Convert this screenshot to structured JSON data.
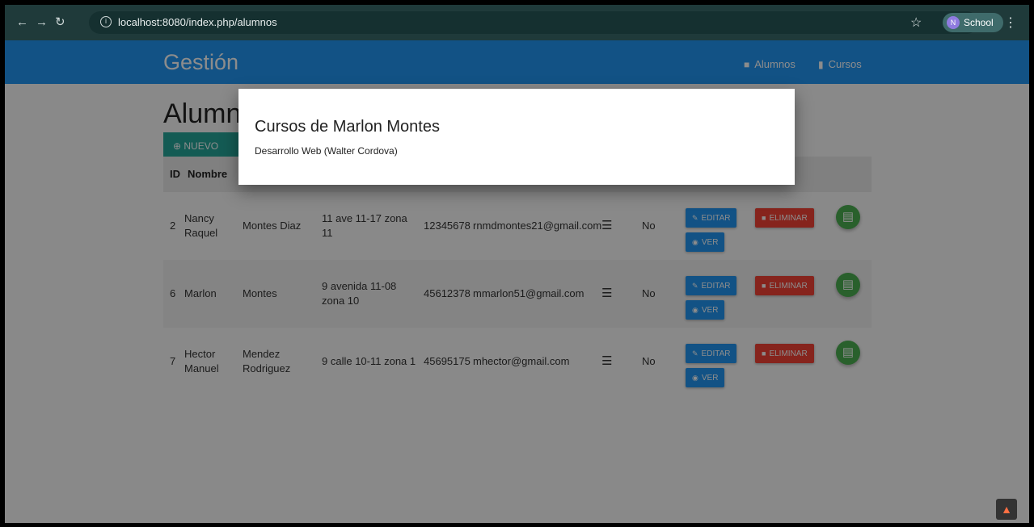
{
  "browser": {
    "url": "localhost:8080/index.php/alumnos",
    "profile_label": "School",
    "profile_initial": "N"
  },
  "navbar": {
    "brand": "Gestión",
    "links": [
      {
        "label": "Alumnos",
        "icon": "student-icon"
      },
      {
        "label": "Cursos",
        "icon": "book-icon"
      }
    ]
  },
  "page": {
    "title": "Alumnos",
    "new_button": "NUEVO ALUMNO"
  },
  "table": {
    "headers": {
      "id": "ID",
      "nombre": "Nombre"
    },
    "rows": [
      {
        "id": "2",
        "nombre": "Nancy Raquel",
        "apellido": "Montes Diaz",
        "direccion": "11 ave 11-17 zona 11",
        "telefono": "12345678",
        "email": "rnmdmontes21@gmail.com",
        "estado": "No"
      },
      {
        "id": "6",
        "nombre": "Marlon",
        "apellido": "Montes",
        "direccion": "9 avenida 11-08 zona 10",
        "telefono": "45612378",
        "email": "mmarlon51@gmail.com",
        "estado": "No"
      },
      {
        "id": "7",
        "nombre": "Hector Manuel",
        "apellido": "Mendez Rodriguez",
        "direccion": "9 calle 10-11 zona 1",
        "telefono": "45695175",
        "email": "mhector@gmail.com",
        "estado": "No"
      }
    ],
    "actions": {
      "edit": "EDITAR",
      "delete": "ELIMINAR",
      "view": "VER"
    }
  },
  "modal": {
    "title": "Cursos de Marlon Montes",
    "body": "Desarrollo Web (Walter Cordova)"
  },
  "colors": {
    "navbar": "#2196f3",
    "edit": "#2196f3",
    "delete": "#f44336",
    "fab": "#4caf50",
    "new": "#26a69a"
  }
}
